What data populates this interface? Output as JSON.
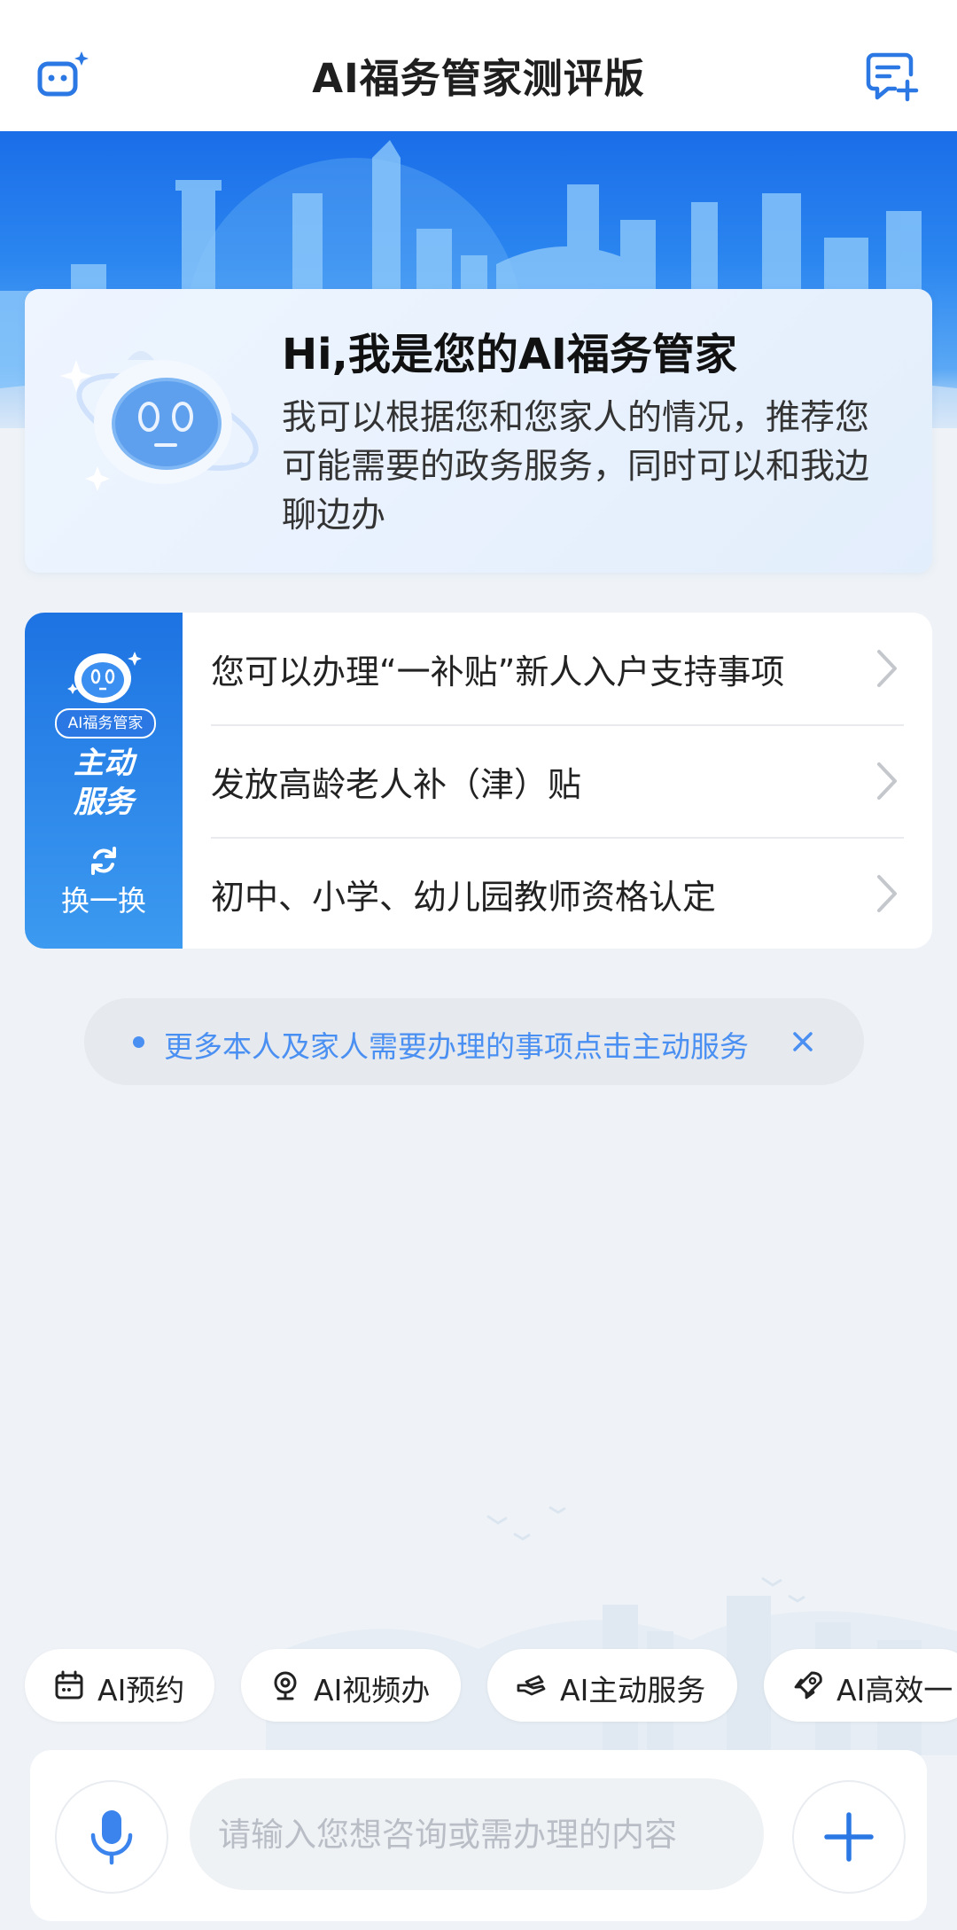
{
  "header": {
    "title": "AI福务管家测评版",
    "left_icon": "robot-sparkle-icon",
    "right_icon": "new-chat-icon"
  },
  "intro": {
    "title": "Hi,我是您的AI福务管家",
    "text": "我可以根据您和您家人的情况，推荐您可能需要的政务服务，同时可以和我边聊边办"
  },
  "active_service": {
    "badge": "AI福务管家",
    "title_line1": "主动",
    "title_line2": "服务",
    "refresh_label": "换一换",
    "items": [
      {
        "label": "您可以办理“一补贴”新人入户支持事项"
      },
      {
        "label": "发放高龄老人补（津）贴"
      },
      {
        "label": "初中、小学、幼儿园教师资格认定"
      }
    ]
  },
  "tip": {
    "text": "更多本人及家人需要办理的事项点击主动服务"
  },
  "quick_actions": [
    {
      "label": "AI预约",
      "icon": "calendar-icon"
    },
    {
      "label": "AI视频办",
      "icon": "webcam-icon"
    },
    {
      "label": "AI主动服务",
      "icon": "hand-service-icon"
    },
    {
      "label": "AI高效一",
      "icon": "rocket-icon"
    }
  ],
  "input": {
    "placeholder": "请输入您想咨询或需办理的内容"
  },
  "colors": {
    "primary": "#2b78e4",
    "tip_text": "#4a8ff2",
    "page_bg": "#eff3f7"
  }
}
